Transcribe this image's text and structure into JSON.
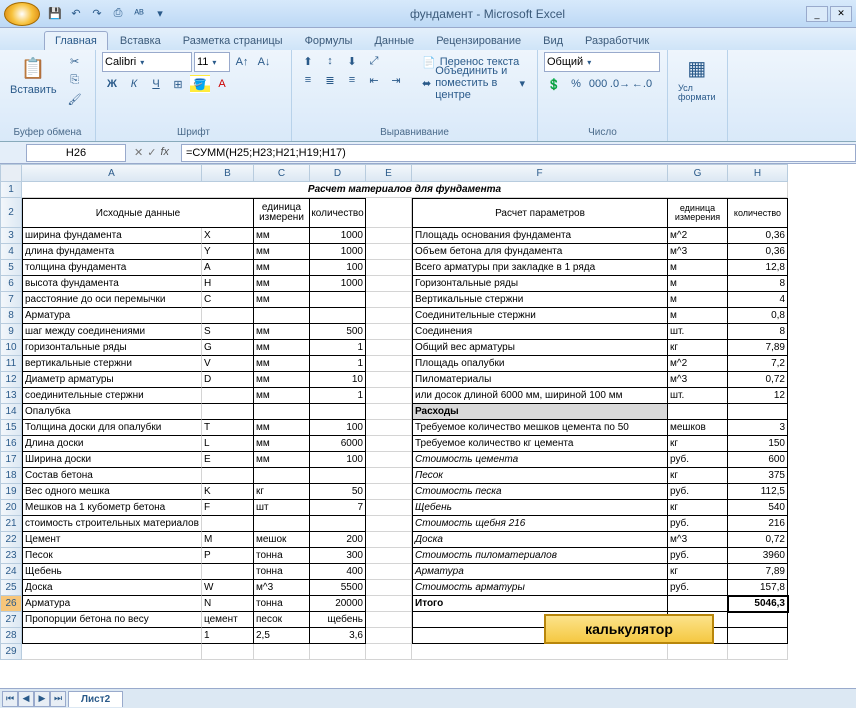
{
  "app": {
    "title": "фундамент - Microsoft Excel"
  },
  "qat": {
    "save": "💾",
    "undo": "↶",
    "redo": "↷",
    "print": "🖶",
    "spell": "✓"
  },
  "tabs": [
    "Главная",
    "Вставка",
    "Разметка страницы",
    "Формулы",
    "Данные",
    "Рецензирование",
    "Вид",
    "Разработчик"
  ],
  "ribbon": {
    "clipboard": {
      "paste": "Вставить",
      "label": "Буфер обмена"
    },
    "font": {
      "name": "Calibri",
      "size": "11",
      "label": "Шрифт"
    },
    "align": {
      "wrap": "Перенос текста",
      "merge": "Объединить и поместить в центре",
      "label": "Выравнивание"
    },
    "number": {
      "format": "Общий",
      "label": "Число"
    },
    "styles": {
      "cond": "Усл\nформати"
    }
  },
  "namebox": "H26",
  "formula": "=СУММ(H25;H23;H21;H19;H17)",
  "cols": [
    "A",
    "B",
    "C",
    "D",
    "E",
    "F",
    "G",
    "H"
  ],
  "title_row": "Расчет материалов для фундамента",
  "left_header": {
    "a": "Исходные данные",
    "c": "единица измерени",
    "d": "количество"
  },
  "right_header": {
    "f": "Расчет параметров",
    "g": "единица измерения",
    "h": "количество"
  },
  "rows": [
    {
      "n": 3,
      "a": "ширина фундамента",
      "b": "X",
      "c": "мм",
      "d": "1000",
      "f": "Площадь основания фундамента",
      "g": "м^2",
      "h": "0,36"
    },
    {
      "n": 4,
      "a": "длина фундамента",
      "b": "Y",
      "c": "мм",
      "d": "1000",
      "f": "Объем бетона для фундамента",
      "g": "м^3",
      "h": "0,36"
    },
    {
      "n": 5,
      "a": "толщина фундамента",
      "b": "A",
      "c": "мм",
      "d": "100",
      "f": "Всего арматуры при закладке в 1 ряда",
      "g": "м",
      "h": "12,8"
    },
    {
      "n": 6,
      "a": "высота фундамента",
      "b": "H",
      "c": "мм",
      "d": "1000",
      "f": "Горизонтальные ряды",
      "g": "м",
      "h": "8"
    },
    {
      "n": 7,
      "a": "расстояние до оси перемычки",
      "b": "C",
      "c": "мм",
      "d": "",
      "f": "Вертикальные стержни",
      "g": "м",
      "h": "4"
    },
    {
      "n": 8,
      "a": "Арматура",
      "b": "",
      "c": "",
      "d": "",
      "f": "Соединительные стержни",
      "g": "м",
      "h": "0,8"
    },
    {
      "n": 9,
      "a": "шаг между соединениями",
      "b": "S",
      "c": "мм",
      "d": "500",
      "f": "Соединения",
      "g": "шт.",
      "h": "8"
    },
    {
      "n": 10,
      "a": "горизонтальные ряды",
      "b": "G",
      "c": "мм",
      "d": "1",
      "f": "Общий вес арматуры",
      "g": "кг",
      "h": "7,89"
    },
    {
      "n": 11,
      "a": "вертикальные стержни",
      "b": "V",
      "c": "мм",
      "d": "1",
      "f": "Площадь опалубки",
      "g": "м^2",
      "h": "7,2"
    },
    {
      "n": 12,
      "a": "Диаметр арматуры",
      "b": "D",
      "c": "мм",
      "d": "10",
      "f": "Пиломатериалы",
      "g": "м^3",
      "h": "0,72"
    },
    {
      "n": 13,
      "a": "соединительные стержни",
      "b": "",
      "c": "мм",
      "d": "1",
      "f": "или досок длиной 6000 мм, шириной 100 мм",
      "g": "шт.",
      "h": "12"
    },
    {
      "n": 14,
      "a": "Опалубка",
      "b": "",
      "c": "",
      "d": "",
      "f": "Расходы",
      "g": "",
      "h": "",
      "bold_f": true,
      "shade_f": true
    },
    {
      "n": 15,
      "a": "Толщина доски для опалубки",
      "b": "T",
      "c": "мм",
      "d": "100",
      "f": "Требуемое количество мешков цемента по 50",
      "g": "мешков",
      "h": "3"
    },
    {
      "n": 16,
      "a": "Длина доски",
      "b": "L",
      "c": "мм",
      "d": "6000",
      "f": "Требуемое количество кг цемента",
      "g": "кг",
      "h": "150"
    },
    {
      "n": 17,
      "a": "Ширина доски",
      "b": "E",
      "c": "мм",
      "d": "100",
      "f": "Стоимость цемента",
      "g": "руб.",
      "h": "600",
      "ital_f": true
    },
    {
      "n": 18,
      "a": "Состав бетона",
      "b": "",
      "c": "",
      "d": "",
      "f": "Песок",
      "g": "кг",
      "h": "375",
      "ital_f": true
    },
    {
      "n": 19,
      "a": "Вес одного мешка",
      "b": "K",
      "c": "кг",
      "d": "50",
      "f": "Стоимость песка",
      "g": "руб.",
      "h": "112,5",
      "ital_f": true
    },
    {
      "n": 20,
      "a": "Мешков на 1 кубометр бетона",
      "b": "F",
      "c": "шт",
      "d": "7",
      "f": "Щебень",
      "g": "кг",
      "h": "540",
      "ital_f": true
    },
    {
      "n": 21,
      "a": "стоимость строительных материалов",
      "b": "",
      "c": "",
      "d": "",
      "f": "Стоимость щебня 216",
      "g": "руб.",
      "h": "216",
      "ital_f": true
    },
    {
      "n": 22,
      "a": "Цемент",
      "b": "M",
      "c": "мешок",
      "d": "200",
      "f": "Доска",
      "g": "м^3",
      "h": "0,72",
      "ital_f": true
    },
    {
      "n": 23,
      "a": "Песок",
      "b": "P",
      "c": "тонна",
      "d": "300",
      "f": "Стоимость пиломатериалов",
      "g": "руб.",
      "h": "3960",
      "ital_f": true
    },
    {
      "n": 24,
      "a": "Щебень",
      "b": "",
      "c": "тонна",
      "d": "400",
      "f": "Арматура",
      "g": "кг",
      "h": "7,89",
      "ital_f": true
    },
    {
      "n": 25,
      "a": "Доска",
      "b": "W",
      "c": "м^3",
      "d": "5500",
      "f": "Стоимость арматуры",
      "g": "руб.",
      "h": "157,8",
      "ital_f": true
    },
    {
      "n": 26,
      "a": "Арматура",
      "b": "N",
      "c": "тонна",
      "d": "20000",
      "f": "Итого",
      "g": "",
      "h": "5046,3",
      "bold_f": true,
      "bold_h": true,
      "sel": true
    },
    {
      "n": 27,
      "a": "Пропорции бетона по весу",
      "b": "цемент",
      "c": "песок",
      "d": "щебень",
      "f": "",
      "g": "",
      "h": ""
    },
    {
      "n": 28,
      "a": "",
      "b": "1",
      "c": "2,5",
      "d": "3,6",
      "f": "",
      "g": "",
      "h": ""
    }
  ],
  "extra_rows": [
    29
  ],
  "calc_button": "калькулятор",
  "sheet": "Лист2"
}
